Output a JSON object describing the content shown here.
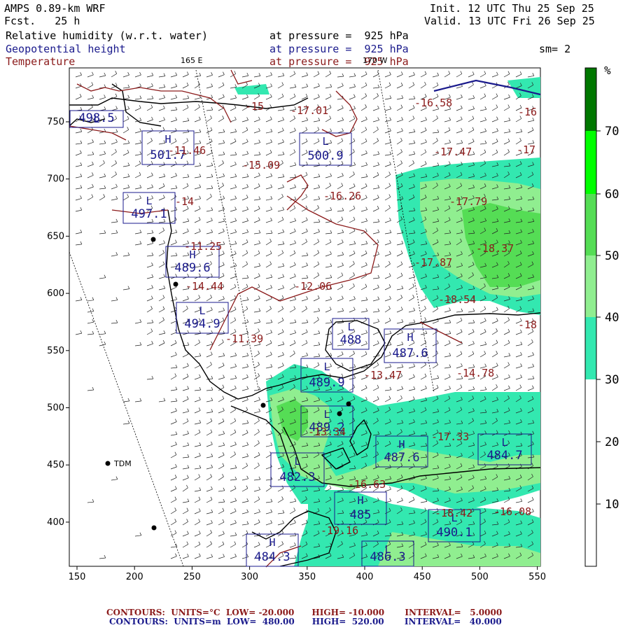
{
  "header": {
    "model": "AMPS 0.89-km WRF",
    "fcst": "Fcst.   25 h",
    "init": "Init. 12 UTC Thu 25 Sep 25",
    "valid": "Valid. 13 UTC Fri 26 Sep 25",
    "field1": "Relative humidity (w.r.t. water)",
    "field2": "Geopotential height",
    "field3": "Temperature",
    "pressure1": "at pressure =  925 hPa",
    "pressure2": "at pressure =  925 hPa",
    "pressure3": "at pressure =  925 hPa",
    "smoothing": "sm= 2",
    "lon_165e": "165 E",
    "lon_170w": "170 W"
  },
  "colors": {
    "rh_30_40": "#33e8b0",
    "rh_40_50": "#90ee90",
    "rh_50_60": "#55dd55",
    "rh_60_70": "#00ff00",
    "rh_70_plus": "#007700",
    "temp_contour": "#8b1a1a",
    "height_contour": "#1a1a8c",
    "coast": "#000000"
  },
  "colorbar": {
    "unit": "%",
    "labels": [
      "70",
      "60",
      "50",
      "40",
      "30",
      "20",
      "10"
    ]
  },
  "axes": {
    "x_ticks": [
      "150",
      "200",
      "250",
      "300",
      "350",
      "400",
      "450",
      "500",
      "550"
    ],
    "y_ticks": [
      "750",
      "700",
      "650",
      "600",
      "550",
      "500",
      "450",
      "400"
    ]
  },
  "stations": {
    "tdm": "TDM"
  },
  "height_labels": [
    "498.5",
    "501.7",
    "500.9",
    "497.1",
    "489.6",
    "494.9",
    "488",
    "487.6",
    "489.9",
    "489.2",
    "487.6",
    "484.7",
    "482.3",
    "485",
    "490.1",
    "486.3",
    "484.3"
  ],
  "temp_labels": [
    "-15",
    "-17.01",
    "-16.58",
    "-16",
    "-11.46",
    "-15.09",
    "-17.47",
    "-17",
    "-16.26",
    "-17.79",
    "-14",
    "-11.25",
    "-18.37",
    "-17.87",
    "-14.44",
    "-12.06",
    "-18.54",
    "-11.39",
    "-18",
    "-13.47",
    "-14.78",
    "-13.34",
    "-17.33",
    "-16.63",
    "-19.16",
    "-18.42",
    "-16.08"
  ],
  "footer": {
    "line1": "CONTOURS:  UNITS=°C  LOW= -20.000      HIGH= -10.000       INTERVAL=   5.0000",
    "line2": "CONTOURS:  UNITS=m  LOW=  480.00      HIGH=  520.00       INTERVAL=   40.000"
  }
}
